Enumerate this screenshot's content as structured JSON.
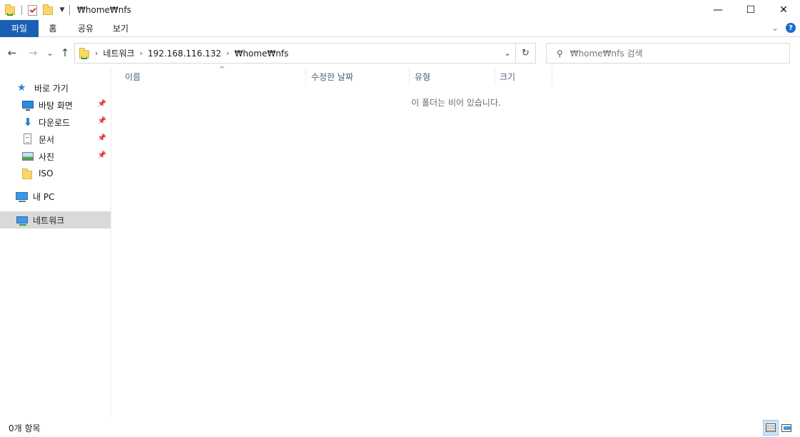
{
  "window": {
    "title": "₩home₩nfs",
    "minimize": "—",
    "maximize": "☐",
    "close": "✕"
  },
  "ribbon": {
    "tabs": [
      "파일",
      "홈",
      "공유",
      "보기"
    ]
  },
  "nav": {
    "back": "←",
    "forward": "→",
    "recent": "⌄",
    "up": "↑"
  },
  "address": {
    "crumbs": [
      "네트워크",
      "192.168.116.132",
      "₩home₩nfs"
    ]
  },
  "search": {
    "placeholder": "₩home₩nfs 검색"
  },
  "sidebar": {
    "quick_access": "바로 가기",
    "items": [
      {
        "label": "바탕 화면",
        "pinned": true
      },
      {
        "label": "다운로드",
        "pinned": true
      },
      {
        "label": "문서",
        "pinned": true
      },
      {
        "label": "사진",
        "pinned": true
      },
      {
        "label": "ISO",
        "pinned": false
      }
    ],
    "this_pc": "내 PC",
    "network": "네트워크"
  },
  "columns": [
    "이름",
    "수정한 날짜",
    "유형",
    "크기"
  ],
  "empty_message": "이 폴더는 비어 있습니다.",
  "status": {
    "count": "0개 항목"
  },
  "icons": {
    "pin": "pin-icon",
    "star": "star-icon",
    "refresh": "refresh-icon",
    "search": "search-icon"
  },
  "colors": {
    "file_tab": "#1a5fb4",
    "selected_nav": "#d9d9d9",
    "column_header_text": "#4c607a"
  }
}
